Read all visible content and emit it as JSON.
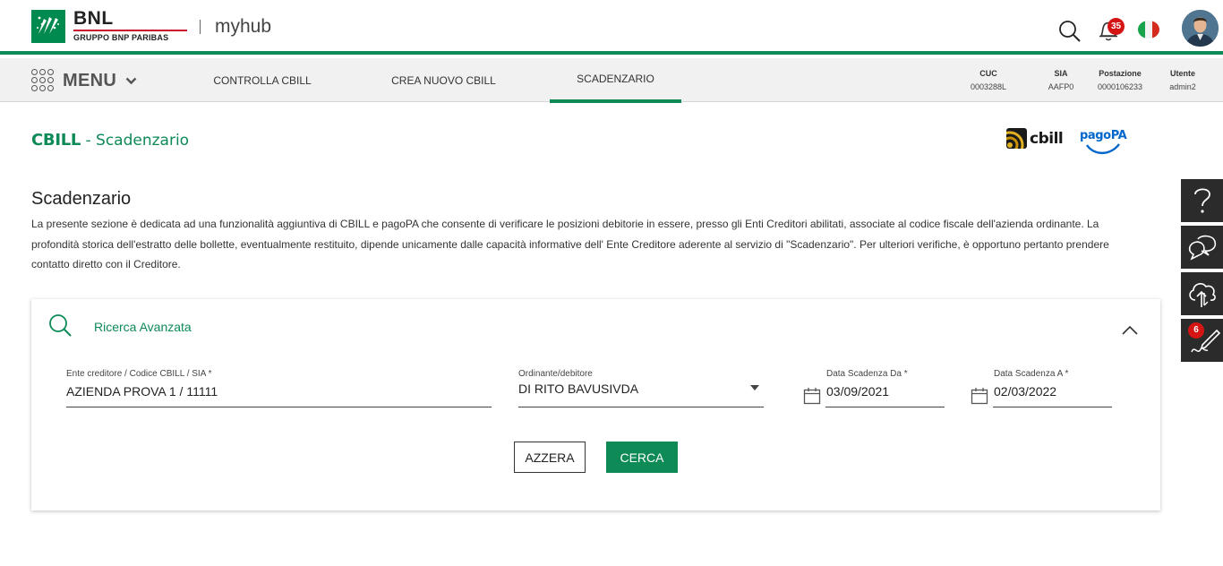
{
  "header": {
    "brand": "BNL",
    "brand_sub": "GRUPPO BNP PARIBAS",
    "app_name": "myhub",
    "notifications_count": "35",
    "language": "Italiano",
    "colors": {
      "brand_green": "#0e8a57",
      "badge_red": "#d51414"
    }
  },
  "nav": {
    "menu_label": "MENU",
    "tabs": [
      {
        "label": "CONTROLLA CBILL",
        "active": false
      },
      {
        "label": "CREA NUOVO CBILL",
        "active": false
      },
      {
        "label": "SCADENZARIO",
        "active": true
      }
    ],
    "info": [
      {
        "key": "CUC",
        "value": "0003288L"
      },
      {
        "key": "SIA",
        "value": "AAFP0"
      },
      {
        "key": "Postazione",
        "value": "0000106233"
      },
      {
        "key": "Utente",
        "value": "admin2"
      }
    ]
  },
  "page": {
    "title_main": "CBILL",
    "title_sep": " - ",
    "title_sub": "Scadenzario",
    "logo_cbill": "cbill",
    "logo_pagopa": "pagoPA",
    "section_title": "Scadenzario",
    "section_desc": "La presente sezione è dedicata ad una funzionalità aggiuntiva di CBILL e pagoPA che consente di verificare le posizioni debitorie in essere, presso gli Enti Creditori abilitati, associate al codice fiscale dell'azienda ordinante. La profondità storica dell'estratto delle bollette, eventualmente restituito, dipende unicamente dalle capacità informative dell' Ente Creditore aderente al servizio di \"Scadenzario\". Per ulteriori verifiche, è opportuno pertanto prendere contatto diretto con il Creditore."
  },
  "search": {
    "title": "Ricerca Avanzata",
    "fields": {
      "ente": {
        "label": "Ente creditore / Codice CBILL / SIA *",
        "value": "AZIENDA PROVA 1 / 11111"
      },
      "ordinante": {
        "label": "Ordinante/debitore",
        "value": "DI RITO BAVUSIVDA"
      },
      "data_da": {
        "label": "Data Scadenza Da *",
        "value": "03/09/2021"
      },
      "data_a": {
        "label": "Data Scadenza A *",
        "value": "02/03/2022"
      }
    },
    "reset_label": "AZZERA",
    "submit_label": "CERCA"
  },
  "side_toolbar": {
    "items": [
      {
        "icon": "help-icon"
      },
      {
        "icon": "chat-icon"
      },
      {
        "icon": "cloud-upload-icon"
      },
      {
        "icon": "signature-icon",
        "badge": "6"
      }
    ]
  }
}
